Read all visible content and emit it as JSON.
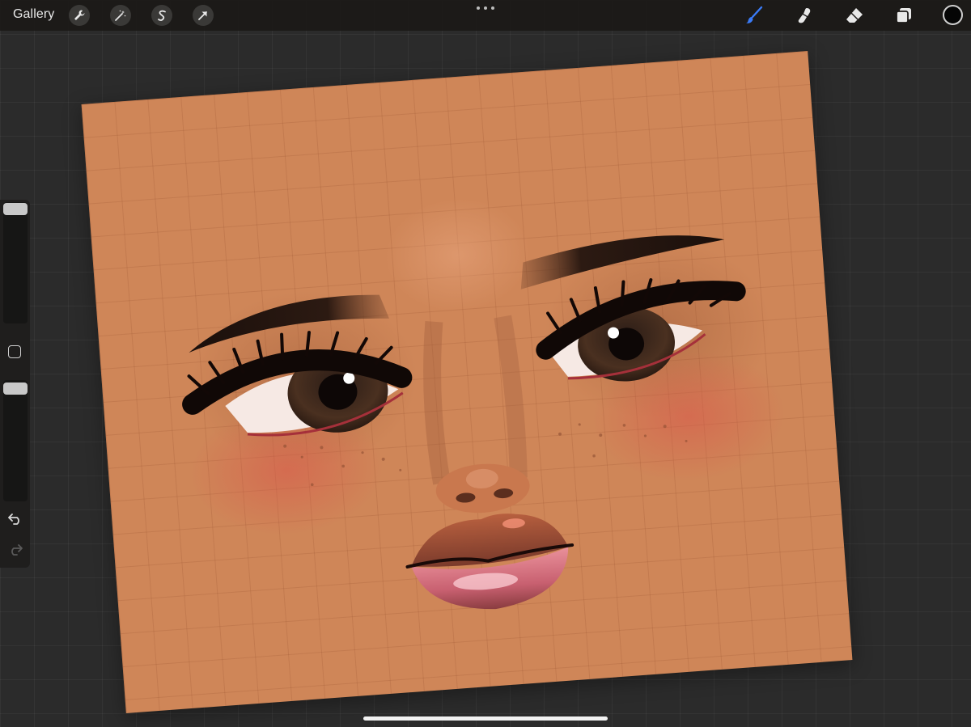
{
  "toolbar": {
    "gallery_label": "Gallery",
    "left_tools": [
      "wrench-icon",
      "magic-wand-icon",
      "selection-icon",
      "transform-arrow-icon"
    ],
    "right_tools": [
      "brush-icon",
      "smudge-icon",
      "eraser-icon",
      "layers-icon"
    ],
    "active_tool": "brush-icon",
    "current_color": "#050505",
    "accent_color": "#3a7bf7"
  },
  "sidebar": {
    "brush_size_level": 0.0,
    "opacity_level": 0.0
  },
  "canvas": {
    "skin_color": "#cf8658",
    "rotation_deg": -4.2
  }
}
